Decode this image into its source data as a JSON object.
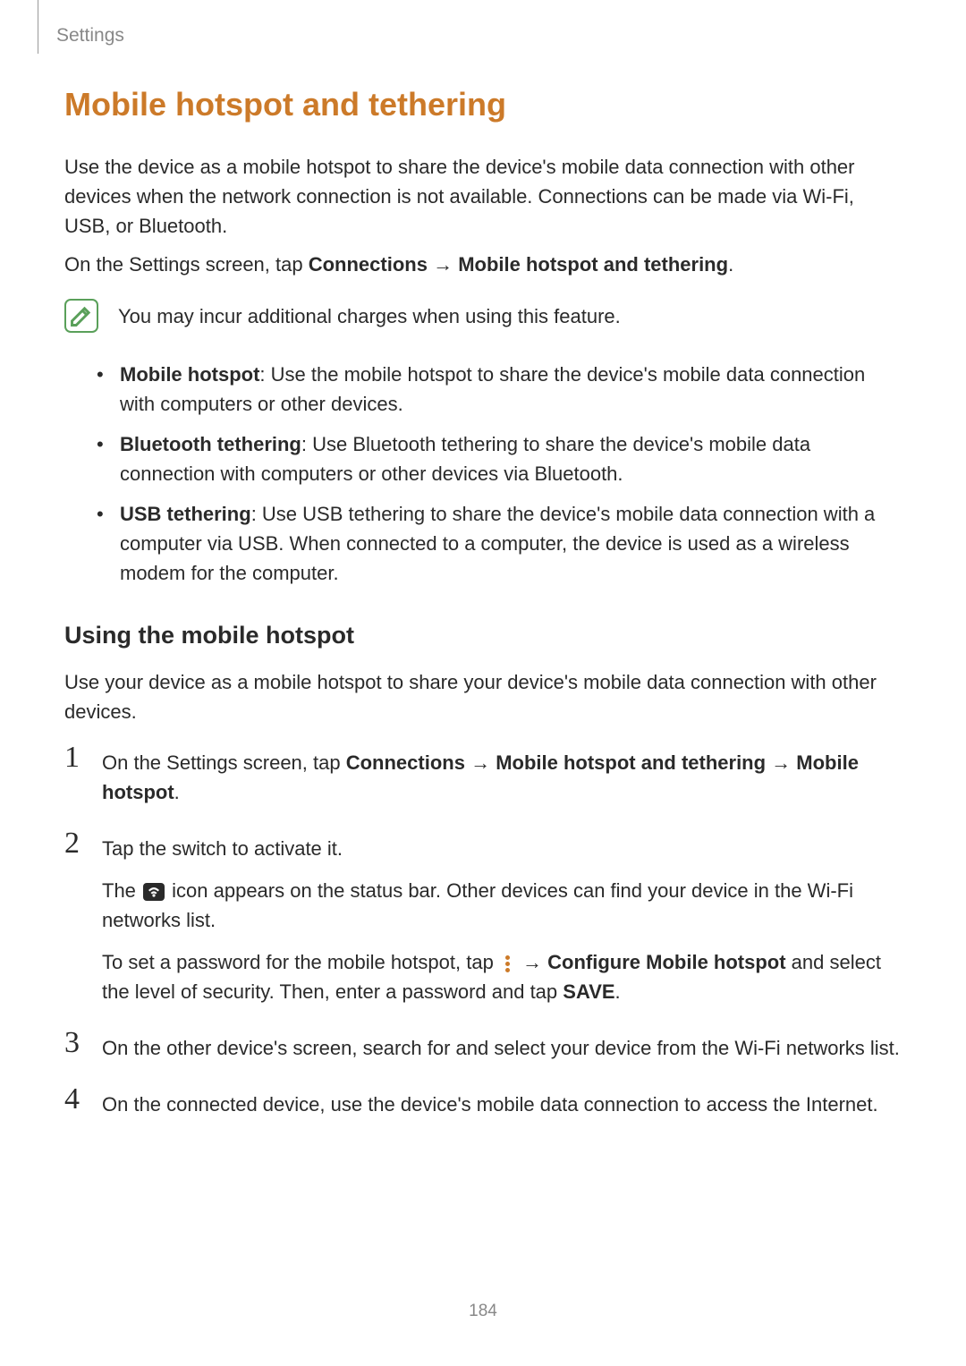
{
  "header": {
    "breadcrumb": "Settings"
  },
  "main": {
    "title": "Mobile hotspot and tethering",
    "intro": "Use the device as a mobile hotspot to share the device's mobile data connection with other devices when the network connection is not available. Connections can be made via Wi-Fi, USB, or Bluetooth.",
    "nav_prefix": "On the Settings screen, tap ",
    "nav_connections": "Connections",
    "nav_arrow": " → ",
    "nav_target": "Mobile hotspot and tethering",
    "note": "You may incur additional charges when using this feature.",
    "bullets": [
      {
        "label": "Mobile hotspot",
        "text": ": Use the mobile hotspot to share the device's mobile data connection with computers or other devices."
      },
      {
        "label": "Bluetooth tethering",
        "text": ": Use Bluetooth tethering to share the device's mobile data connection with computers or other devices via Bluetooth."
      },
      {
        "label": "USB tethering",
        "text": ": Use USB tethering to share the device's mobile data connection with a computer via USB. When connected to a computer, the device is used as a wireless modem for the computer."
      }
    ],
    "subsection_title": "Using the mobile hotspot",
    "subsection_intro": "Use your device as a mobile hotspot to share your device's mobile data connection with other devices.",
    "steps": {
      "s1_prefix": "On the Settings screen, tap ",
      "s1_connections": "Connections",
      "s1_arrow1": " → ",
      "s1_mht": "Mobile hotspot and tethering",
      "s1_arrow2": " → ",
      "s1_mh": "Mobile hotspot",
      "s1_period": ".",
      "s2_line1": "Tap the switch to activate it.",
      "s2_line2_a": "The ",
      "s2_line2_b": " icon appears on the status bar. Other devices can find your device in the Wi-Fi networks list.",
      "s2_line3_a": "To set a password for the mobile hotspot, tap ",
      "s2_line3_arrow": " → ",
      "s2_line3_conf": "Configure Mobile hotspot",
      "s2_line3_b": " and select the level of security. Then, enter a password and tap ",
      "s2_line3_save": "SAVE",
      "s2_line3_period": ".",
      "s3": "On the other device's screen, search for and select your device from the Wi-Fi networks list.",
      "s4": "On the connected device, use the device's mobile data connection to access the Internet."
    }
  },
  "page_number": "184",
  "icons": {
    "note": "note-pencil-icon",
    "hotspot": "hotspot-status-icon",
    "more": "more-options-icon"
  }
}
